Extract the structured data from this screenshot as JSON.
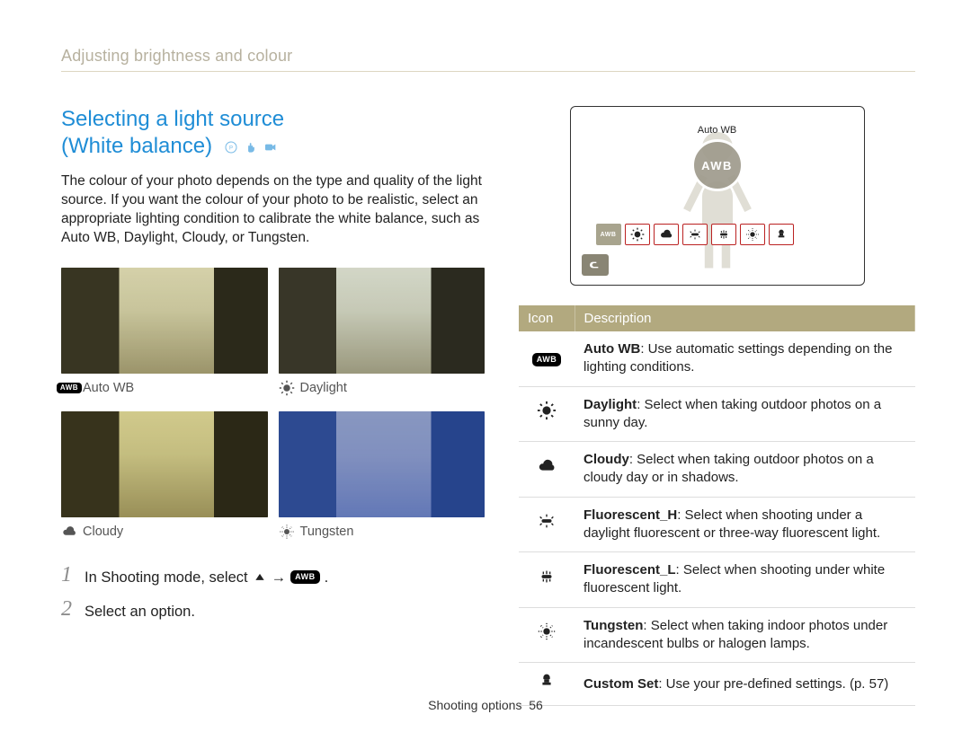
{
  "breadcrumb": "Adjusting brightness and colour",
  "heading_line1": "Selecting a light source",
  "heading_line2": "(White balance)",
  "intro": "The colour of your photo depends on the type and quality of the light source. If you want the colour of your photo to be realistic, select an appropriate lighting condition to calibrate the white balance, such as Auto WB, Daylight, Cloudy, or Tungsten.",
  "samples": [
    {
      "label": "Auto WB",
      "icon": "awb"
    },
    {
      "label": "Daylight",
      "icon": "daylight"
    },
    {
      "label": "Cloudy",
      "icon": "cloudy"
    },
    {
      "label": "Tungsten",
      "icon": "tungsten"
    }
  ],
  "steps": [
    {
      "num": "1",
      "text_a": "In Shooting mode, select",
      "text_b": "→",
      "text_c": "."
    },
    {
      "num": "2",
      "text_a": "Select an option."
    }
  ],
  "display": {
    "featured_label": "Auto WB",
    "featured_code": "AWB",
    "strip": [
      "awb",
      "daylight",
      "cloudy",
      "fluor_h",
      "fluor_l",
      "tungsten",
      "custom"
    ]
  },
  "table": {
    "headers": [
      "Icon",
      "Description"
    ],
    "rows": [
      {
        "icon": "awb",
        "bold": "Auto WB",
        "desc": ": Use automatic settings depending on the lighting conditions."
      },
      {
        "icon": "daylight",
        "bold": "Daylight",
        "desc": ": Select when taking outdoor photos on a sunny day."
      },
      {
        "icon": "cloudy",
        "bold": "Cloudy",
        "desc": ": Select when taking outdoor photos on a cloudy day or in shadows."
      },
      {
        "icon": "fluor_h",
        "bold": "Fluorescent_H",
        "desc": ": Select when shooting under a daylight fluorescent or three-way fluorescent light."
      },
      {
        "icon": "fluor_l",
        "bold": "Fluorescent_L",
        "desc": ": Select when shooting under white fluorescent light."
      },
      {
        "icon": "tungsten",
        "bold": "Tungsten",
        "desc": ": Select when taking indoor photos under incandescent bulbs or halogen lamps."
      },
      {
        "icon": "custom",
        "bold": "Custom Set",
        "desc": ": Use your pre-defined settings. (p. 57)"
      }
    ]
  },
  "footer_section": "Shooting options",
  "footer_page": "56"
}
